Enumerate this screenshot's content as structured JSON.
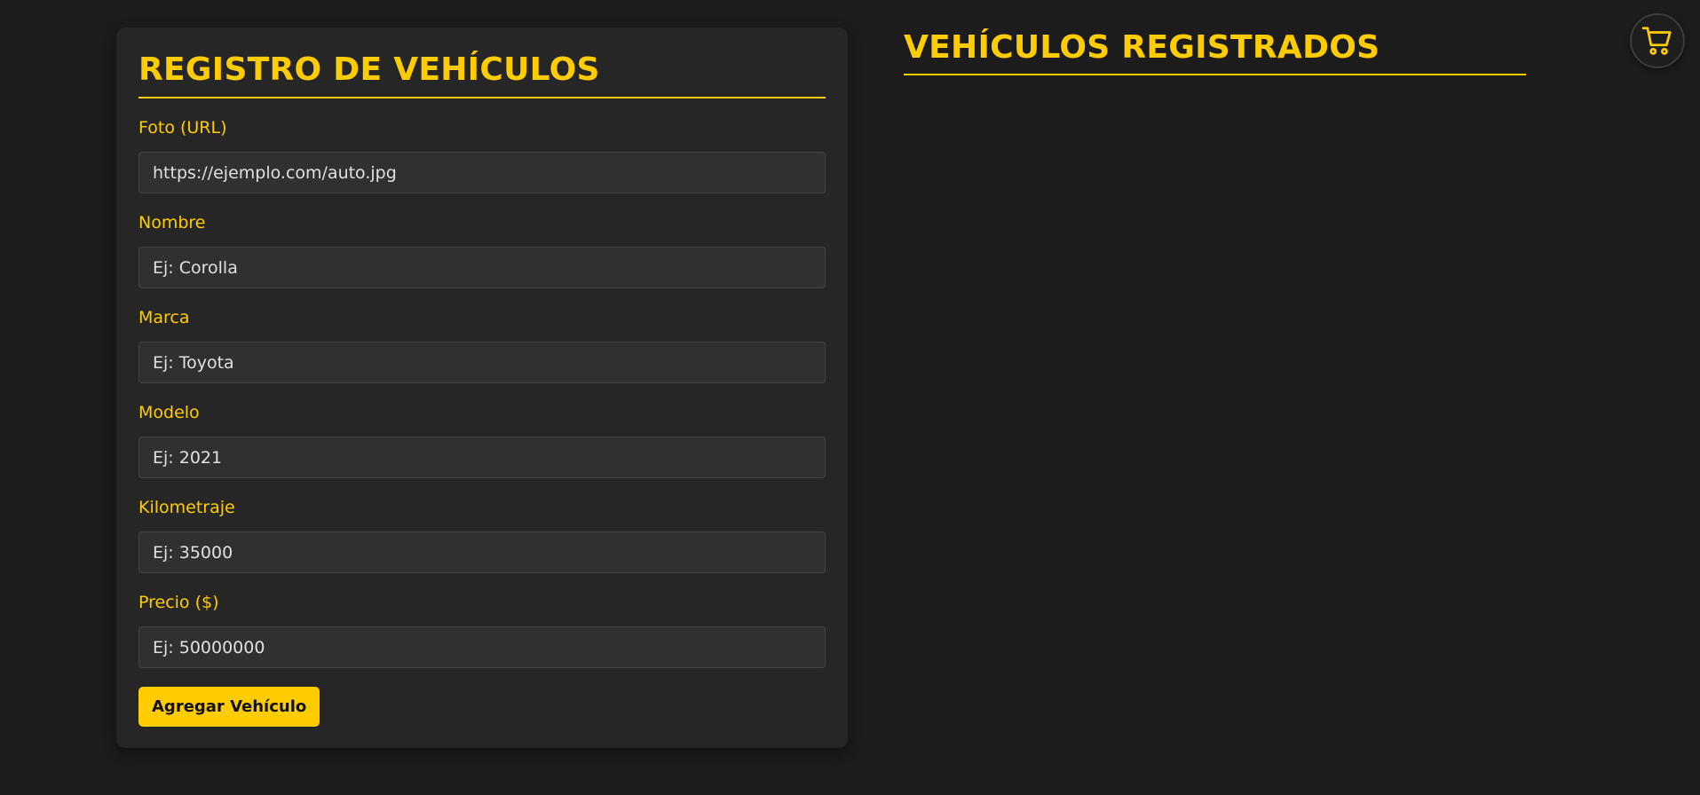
{
  "form": {
    "title": "REGISTRO DE VEHÍCULOS",
    "fields": [
      {
        "label": "Foto (URL)",
        "value": "",
        "placeholder": "https://ejemplo.com/auto.jpg"
      },
      {
        "label": "Nombre",
        "value": "",
        "placeholder": "Ej: Corolla"
      },
      {
        "label": "Marca",
        "value": "",
        "placeholder": "Ej: Toyota"
      },
      {
        "label": "Modelo",
        "value": "",
        "placeholder": "Ej: 2021"
      },
      {
        "label": "Kilometraje",
        "value": "",
        "placeholder": "Ej: 35000"
      },
      {
        "label": "Precio ($)",
        "value": "",
        "placeholder": "Ej: 50000000"
      }
    ],
    "submit_label": "Agregar Vehículo"
  },
  "list": {
    "title": "VEHÍCULOS REGISTRADOS",
    "items": []
  },
  "cart": {
    "icon": "cart-icon"
  },
  "colors": {
    "accent": "#ffcc00",
    "background": "#1c1c1c",
    "card": "#262626",
    "input": "#303030"
  }
}
